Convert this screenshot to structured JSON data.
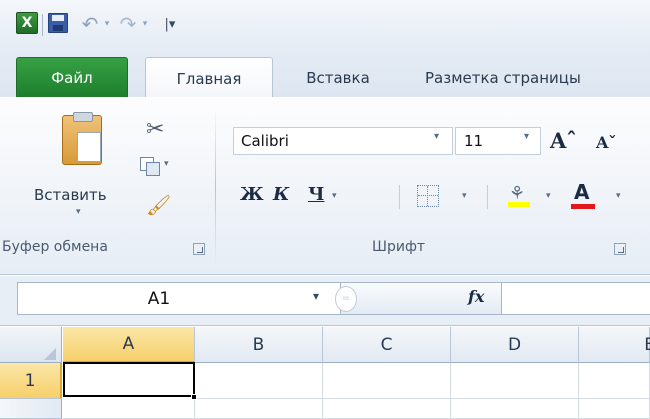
{
  "app": {
    "logo_letter": "X"
  },
  "qat": {
    "customize_glyph": "|▾",
    "undo_glyph": "↶",
    "redo_glyph": "↷",
    "dropdown_glyph": "▾"
  },
  "tabs": [
    {
      "label": "Файл"
    },
    {
      "label": "Главная"
    },
    {
      "label": "Вставка"
    },
    {
      "label": "Разметка страницы"
    }
  ],
  "ribbon": {
    "clipboard": {
      "paste_label": "Вставить",
      "group_label": "Буфер обмена",
      "cut_glyph": "✂",
      "brush_glyph": "🖌"
    },
    "font": {
      "font_name": "Calibri",
      "font_size": "11",
      "grow_label": "Aˆ",
      "shrink_label": "Aˇ",
      "bold_label": "Ж",
      "italic_label": "К",
      "underline_label": "Ч",
      "fill_glyph": "⚘",
      "font_color_label": "A",
      "group_label": "Шрифт",
      "fill_color": "#ffff00",
      "font_color": "#e2161b"
    }
  },
  "formula_bar": {
    "name_box": "A1",
    "fx_label": "fx",
    "formula": ""
  },
  "sheet": {
    "columns": [
      "A",
      "B",
      "C",
      "D",
      "E"
    ],
    "rows": [
      "1",
      ""
    ],
    "active_cell": "A1"
  }
}
